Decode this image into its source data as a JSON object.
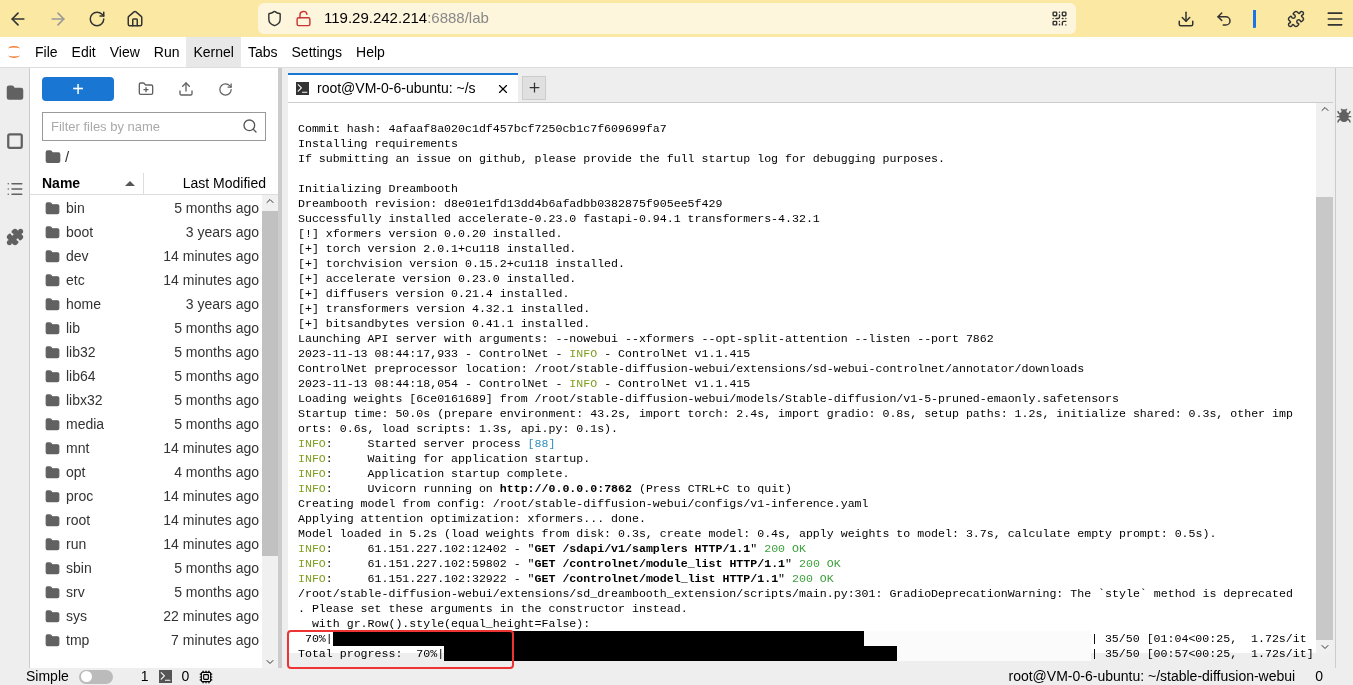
{
  "browser": {
    "url_host": "119.29.242.214",
    "url_rest": ":6888/lab"
  },
  "menu": [
    {
      "label": "File",
      "selected": false
    },
    {
      "label": "Edit",
      "selected": false
    },
    {
      "label": "View",
      "selected": false
    },
    {
      "label": "Run",
      "selected": false
    },
    {
      "label": "Kernel",
      "selected": true
    },
    {
      "label": "Tabs",
      "selected": false
    },
    {
      "label": "Settings",
      "selected": false
    },
    {
      "label": "Help",
      "selected": false
    }
  ],
  "file_browser": {
    "new_label": "+",
    "filter_placeholder": "Filter files by name",
    "path": "/",
    "columns": [
      {
        "label": "Name",
        "sorted": true
      },
      {
        "label": "Last Modified",
        "sorted": false
      }
    ],
    "rows": [
      {
        "name": "bin",
        "modified": "5 months ago"
      },
      {
        "name": "boot",
        "modified": "3 years ago"
      },
      {
        "name": "dev",
        "modified": "14 minutes ago"
      },
      {
        "name": "etc",
        "modified": "14 minutes ago"
      },
      {
        "name": "home",
        "modified": "3 years ago"
      },
      {
        "name": "lib",
        "modified": "5 months ago"
      },
      {
        "name": "lib32",
        "modified": "5 months ago"
      },
      {
        "name": "lib64",
        "modified": "5 months ago"
      },
      {
        "name": "libx32",
        "modified": "5 months ago"
      },
      {
        "name": "media",
        "modified": "5 months ago"
      },
      {
        "name": "mnt",
        "modified": "14 minutes ago"
      },
      {
        "name": "opt",
        "modified": "4 months ago"
      },
      {
        "name": "proc",
        "modified": "14 minutes ago"
      },
      {
        "name": "root",
        "modified": "14 minutes ago"
      },
      {
        "name": "run",
        "modified": "14 minutes ago"
      },
      {
        "name": "sbin",
        "modified": "5 months ago"
      },
      {
        "name": "srv",
        "modified": "5 months ago"
      },
      {
        "name": "sys",
        "modified": "22 minutes ago"
      },
      {
        "name": "tmp",
        "modified": "7 minutes ago"
      }
    ]
  },
  "tabs": [
    {
      "label": "root@VM-0-6-ubuntu: ~/s",
      "selected": true
    }
  ],
  "terminal": {
    "blocks": [
      {
        "lines": [
          {
            "parts": [
              {
                "kind": "plain",
                "text": "Commit hash: 4afaaf8a020c1df457bcf7250cb1c7f609699fa7"
              }
            ]
          },
          {
            "parts": [
              {
                "kind": "plain",
                "text": "Installing requirements"
              }
            ]
          },
          {
            "parts": [
              {
                "kind": "plain",
                "text": "If submitting an issue on github, please provide the full startup log for debugging purposes."
              }
            ]
          }
        ]
      },
      {
        "lines": [
          {
            "parts": [
              {
                "kind": "plain",
                "text": "Initializing Dreambooth"
              }
            ]
          },
          {
            "parts": [
              {
                "kind": "plain",
                "text": "Dreambooth revision: d8e01e1fd13dd4b6afadbb0382875f905ee5f429"
              }
            ]
          },
          {
            "parts": [
              {
                "kind": "plain",
                "text": "Successfully installed accelerate-0.23.0 fastapi-0.94.1 transformers-4.32.1"
              }
            ]
          },
          {
            "parts": [
              {
                "kind": "plain",
                "text": "[!] xformers version 0.0.20 installed."
              }
            ]
          },
          {
            "parts": [
              {
                "kind": "plain",
                "text": "[+] torch version 2.0.1+cu118 installed."
              }
            ]
          },
          {
            "parts": [
              {
                "kind": "plain",
                "text": "[+] torchvision version 0.15.2+cu118 installed."
              }
            ]
          },
          {
            "parts": [
              {
                "kind": "plain",
                "text": "[+] accelerate version 0.23.0 installed."
              }
            ]
          },
          {
            "parts": [
              {
                "kind": "plain",
                "text": "[+] diffusers version 0.21.4 installed."
              }
            ]
          },
          {
            "parts": [
              {
                "kind": "plain",
                "text": "[+] transformers version 4.32.1 installed."
              }
            ]
          },
          {
            "parts": [
              {
                "kind": "plain",
                "text": "[+] bitsandbytes version 0.41.1 installed."
              }
            ]
          },
          {
            "parts": [
              {
                "kind": "plain",
                "text": "Launching API server with arguments: --nowebui --xformers --opt-split-attention --listen --port 7862"
              }
            ]
          },
          {
            "parts": [
              {
                "kind": "plain",
                "text": "2023-11-13 08:44:17,933 - ControlNet - "
              },
              {
                "kind": "info",
                "text": "INFO"
              },
              {
                "kind": "plain",
                "text": " - ControlNet v1.1.415"
              }
            ]
          },
          {
            "parts": [
              {
                "kind": "plain",
                "text": "ControlNet preprocessor location: /root/stable-diffusion-webui/extensions/sd-webui-controlnet/annotator/downloads"
              }
            ]
          },
          {
            "parts": [
              {
                "kind": "plain",
                "text": "2023-11-13 08:44:18,054 - ControlNet - "
              },
              {
                "kind": "info",
                "text": "INFO"
              },
              {
                "kind": "plain",
                "text": " - ControlNet v1.1.415"
              }
            ]
          },
          {
            "parts": [
              {
                "kind": "plain",
                "text": "Loading weights [6ce0161689] from /root/stable-diffusion-webui/models/Stable-diffusion/v1-5-pruned-emaonly.safetensors"
              }
            ]
          },
          {
            "parts": [
              {
                "kind": "plain",
                "text": "Startup time: 50.0s (prepare environment: 43.2s, import torch: 2.4s, import gradio: 0.8s, setup paths: 1.2s, initialize shared: 0.3s, other imp"
              }
            ]
          },
          {
            "parts": [
              {
                "kind": "plain",
                "text": "orts: 0.6s, load scripts: 1.3s, api.py: 0.1s)."
              }
            ]
          },
          {
            "parts": [
              {
                "kind": "info",
                "text": "INFO"
              },
              {
                "kind": "plain",
                "text": ":     Started server process "
              },
              {
                "kind": "num",
                "text": "[88]"
              }
            ]
          },
          {
            "parts": [
              {
                "kind": "info",
                "text": "INFO"
              },
              {
                "kind": "plain",
                "text": ":     Waiting for application startup."
              }
            ]
          },
          {
            "parts": [
              {
                "kind": "info",
                "text": "INFO"
              },
              {
                "kind": "plain",
                "text": ":     Application startup complete."
              }
            ]
          },
          {
            "parts": [
              {
                "kind": "info",
                "text": "INFO"
              },
              {
                "kind": "plain",
                "text": ":     Uvicorn running on "
              },
              {
                "kind": "bold",
                "text": "http://0.0.0.0:7862"
              },
              {
                "kind": "plain",
                "text": " (Press CTRL+C to quit)"
              }
            ]
          },
          {
            "parts": [
              {
                "kind": "plain",
                "text": "Creating model from config: /root/stable-diffusion-webui/configs/v1-inference.yaml"
              }
            ]
          },
          {
            "parts": [
              {
                "kind": "plain",
                "text": "Applying attention optimization: xformers... done."
              }
            ]
          },
          {
            "parts": [
              {
                "kind": "plain",
                "text": "Model loaded in 5.2s (load weights from disk: 0.3s, create model: 0.4s, apply weights to model: 3.7s, calculate empty prompt: 0.5s)."
              }
            ]
          },
          {
            "parts": [
              {
                "kind": "info",
                "text": "INFO"
              },
              {
                "kind": "plain",
                "text": ":     61.151.227.102:12402 - \""
              },
              {
                "kind": "bold",
                "text": "GET /sdapi/v1/samplers HTTP/1.1"
              },
              {
                "kind": "plain",
                "text": "\" "
              },
              {
                "kind": "ok",
                "text": "200 OK"
              }
            ]
          },
          {
            "parts": [
              {
                "kind": "info",
                "text": "INFO"
              },
              {
                "kind": "plain",
                "text": ":     61.151.227.102:59802 - \""
              },
              {
                "kind": "bold",
                "text": "GET /controlnet/module_list HTTP/1.1"
              },
              {
                "kind": "plain",
                "text": "\" "
              },
              {
                "kind": "ok",
                "text": "200 OK"
              }
            ]
          },
          {
            "parts": [
              {
                "kind": "info",
                "text": "INFO"
              },
              {
                "kind": "plain",
                "text": ":     61.151.227.102:32922 - \""
              },
              {
                "kind": "bold",
                "text": "GET /controlnet/model_list HTTP/1.1"
              },
              {
                "kind": "plain",
                "text": "\" "
              },
              {
                "kind": "ok",
                "text": "200 OK"
              }
            ]
          },
          {
            "parts": [
              {
                "kind": "plain",
                "text": "/root/stable-diffusion-webui/extensions/sd_dreambooth_extension/scripts/main.py:301: GradioDeprecationWarning: The `style` method is deprecated"
              }
            ]
          },
          {
            "parts": [
              {
                "kind": "plain",
                "text": ". Please set these arguments in the constructor instead."
              }
            ]
          },
          {
            "parts": [
              {
                "kind": "plain",
                "text": "  with gr.Row().style(equal_height=False):"
              }
            ]
          }
        ]
      }
    ],
    "progress": [
      {
        "label": " 70%|",
        "level": 0.7,
        "stats": "| 35/50 [01:04<00:25,  1.72s/it"
      },
      {
        "label": "Total progress:  70%|",
        "level": 0.7,
        "stats": "| 35/50 [00:57<00:25,  1.72s/it]"
      }
    ]
  },
  "status_bar": {
    "mode_label": "Simple",
    "simple_on": false,
    "terminals": "1",
    "kernels": "0",
    "path": "root@VM-0-6-ubuntu: ~/stable-diffusion-webui",
    "count": "0"
  }
}
